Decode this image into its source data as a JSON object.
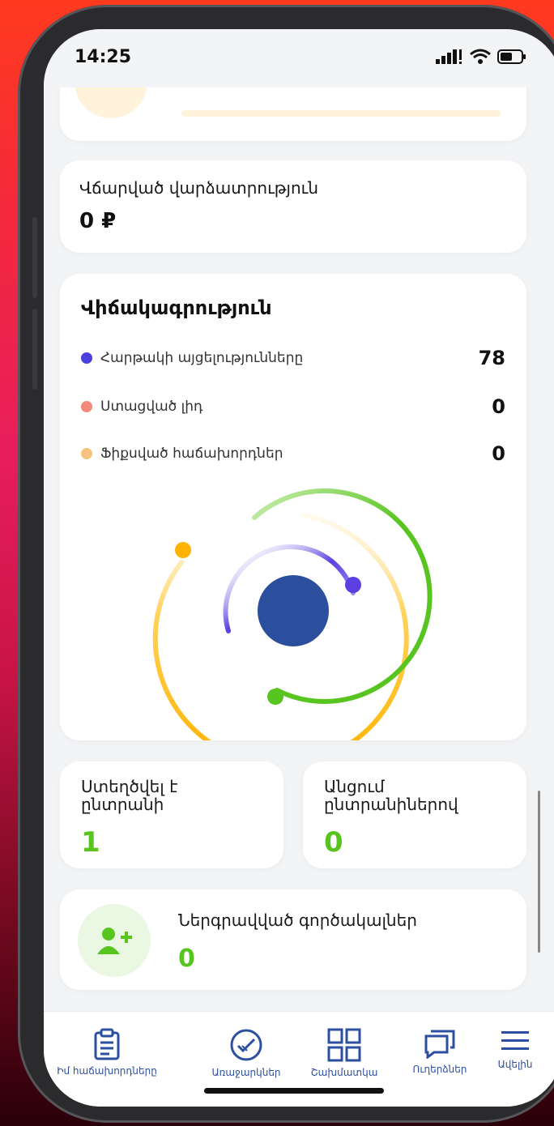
{
  "status_bar": {
    "time": "14:25"
  },
  "top_card": {
    "icon": "plus-coin-icon"
  },
  "paid_fee_card": {
    "label": "Վճարված վարձատրություն",
    "amount": "0 ₽"
  },
  "statistics": {
    "title": "Վիճակագրություն",
    "rows": [
      {
        "label": "Հարթակի այցելությունները",
        "value": "78",
        "color": "#4b3fe0"
      },
      {
        "label": "Ստացված լիդ",
        "value": "0",
        "color": "#f28a7a"
      },
      {
        "label": "Ֆիքսված հաճախորդներ",
        "value": "0",
        "color": "#f6c27f"
      }
    ],
    "colors": {
      "inner_circle": "#2b4f9c",
      "purple_arc": "#5b3fe0",
      "green_arc": "#58c41f",
      "orange_arc": "#ffb300"
    }
  },
  "created_family": {
    "label_line1": "Ստեղծվել է",
    "label_line2": "ընտրանի",
    "value": "1"
  },
  "passing_families": {
    "label_line1": "Անցում",
    "label_line2": "ընտրանիներով",
    "value": "0"
  },
  "invited_agents": {
    "label": "Ներգրավված գործակալներ",
    "value": "0",
    "icon": "add-user-icon"
  },
  "tabbar": {
    "items": [
      {
        "label": "Իմ հաճախորդները",
        "icon": "clipboard-icon"
      },
      {
        "label": "Առաջարկներ",
        "icon": "check-badge-icon"
      },
      {
        "label": "Շախմատկա",
        "icon": "grid-icon"
      },
      {
        "label": "Ուղերձներ",
        "icon": "chat-icon"
      },
      {
        "label": "Ավելին",
        "icon": "menu-icon"
      }
    ]
  }
}
